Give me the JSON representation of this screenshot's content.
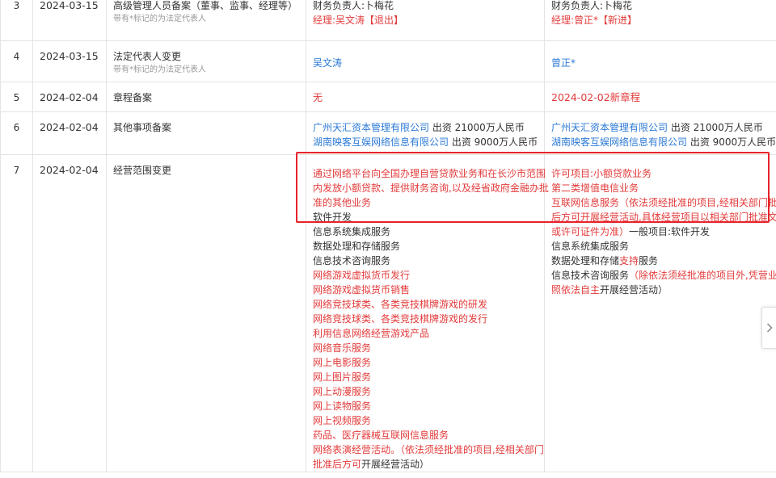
{
  "rows": [
    {
      "num": "3",
      "date": "2024-03-15",
      "item": "高级管理人员备案（董事、监事、经理等）",
      "note": "带有*标记的为法定代表人",
      "before": {
        "line1": "财务负责人:卜梅花",
        "line2": "经理:吴文涛【退出】"
      },
      "after": {
        "line1": "财务负责人:卜梅花",
        "line2": "经理:曾正*【新进】"
      }
    },
    {
      "num": "4",
      "date": "2024-03-15",
      "item": "法定代表人变更",
      "note": "带有*标记的为法定代表人",
      "before": "吴文涛",
      "after": "曾正*"
    },
    {
      "num": "5",
      "date": "2024-02-04",
      "item": "章程备案",
      "before": "无",
      "after": "2024-02-02新章程"
    },
    {
      "num": "6",
      "date": "2024-02-04",
      "item": "其他事项备案",
      "before": [
        {
          "company": "广州天汇资本管理有限公司",
          "amount": " 出资 21000万人民币"
        },
        {
          "company": "湖南映客互娱网络信息有限公司",
          "amount": " 出资 9000万人民币"
        }
      ],
      "after": [
        {
          "company": "广州天汇资本管理有限公司",
          "amount": " 出资 21000万人民币"
        },
        {
          "company": "湖南映客互娱网络信息有限公司",
          "amount": " 出资 9000万人民币"
        }
      ]
    },
    {
      "num": "7",
      "date": "2024-02-04",
      "item": "经营范围变更",
      "before_scope": {
        "red_intro_1": "通过网络平台向全国办理自营贷款业务和在长沙市范围",
        "red_intro_2": "内发放小额贷款、提供财务咨询,以及经省政府金融办批",
        "red_intro_3": "准的其他业务",
        "lines": [
          {
            "text": "软件开发",
            "color": "dark"
          },
          {
            "text": "信息系统集成服务",
            "color": "dark"
          },
          {
            "text": "数据处理和存储服务",
            "color": "dark"
          },
          {
            "text": "信息技术咨询服务",
            "color": "dark"
          },
          {
            "text": "网络游戏虚拟货币发行",
            "color": "red"
          },
          {
            "text": "网络游戏虚拟货币销售",
            "color": "red"
          },
          {
            "text": "网络竞技球类、各类竞技棋牌游戏的研发",
            "color": "red"
          },
          {
            "text": "网络竞技球类、各类竞技棋牌游戏的发行",
            "color": "red"
          },
          {
            "text": "利用信息网络经营游戏产品",
            "color": "red"
          },
          {
            "text": "网络音乐服务",
            "color": "red"
          },
          {
            "text": "网上电影服务",
            "color": "red"
          },
          {
            "text": "网上图片服务",
            "color": "red"
          },
          {
            "text": "网上动漫服务",
            "color": "red"
          },
          {
            "text": "网上读物服务",
            "color": "red"
          },
          {
            "text": "网上视频服务",
            "color": "red"
          },
          {
            "text": "药品、医疗器械互联网信息服务",
            "color": "red"
          }
        ],
        "tail_red": "网络表演经营活动。（依法须经批准的项目,经相关部门",
        "tail_red_2": "批准后方可",
        "tail_dark_2": "开展经营活动）"
      },
      "after_scope": {
        "l1": "许可项目:小额贷款业务",
        "l2": "第二类增值电信业务",
        "l3": "互联网信息服务（依法须经批准的项目,经相关部门批准",
        "l4": "后方可开展经营活动,具体经营项目以相关部门批准文件",
        "l5_red": "或许可证件为准）",
        "l5_dark": "一般项目:软件开发",
        "l6": "信息系统集成服务",
        "l7_dark": "数据处理和存储",
        "l7_red": "支持",
        "l7_dark2": "服务",
        "l8_dark": "信息技术咨询服务",
        "l8_red": "（除依法须经批准的项目外,凭营业执",
        "l9_red": "照依法自主",
        "l9_dark": "开展经营活动）"
      }
    }
  ],
  "icons": {
    "next": "chevron-right-icon"
  },
  "colors": {
    "red": "#e33b3b",
    "blue": "#2c7ad6",
    "highlight": "#e8232b"
  }
}
